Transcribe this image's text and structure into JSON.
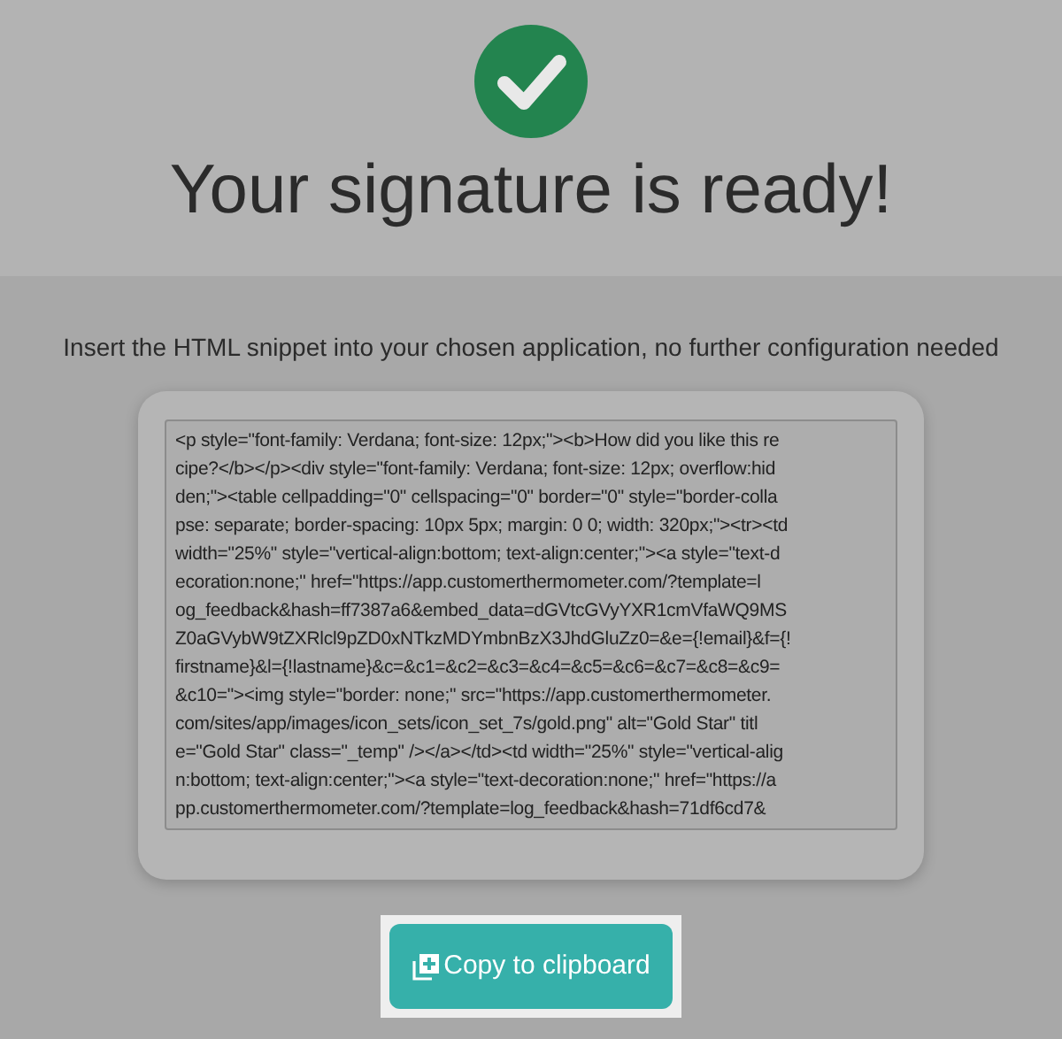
{
  "header": {
    "title": "Your signature is ready!"
  },
  "instruction": "Insert the HTML snippet into your chosen application, no further configuration needed",
  "snippet": {
    "lines": [
      "<p style=\"font-family: Verdana; font-size: 12px;\"><b>How did you like this re",
      "cipe?</b></p><div style=\"font-family: Verdana; font-size: 12px; overflow:hid",
      "den;\"><table cellpadding=\"0\" cellspacing=\"0\" border=\"0\" style=\"border-colla",
      "pse: separate; border-spacing: 10px 5px; margin: 0 0; width: 320px;\"><tr><td",
      "width=\"25%\" style=\"vertical-align:bottom; text-align:center;\"><a style=\"text-d",
      "ecoration:none;\" href=\"https://app.customerthermometer.com/?template=l",
      "og_feedback&hash=ff7387a6&embed_data=dGVtcGVyYXR1cmVfaWQ9MS",
      "Z0aGVybW9tZXRlcl9pZD0xNTkzMDYmbnBzX3JhdGluZz0=&e={!email}&f={!",
      "firstname}&l={!lastname}&c=&c1=&c2=&c3=&c4=&c5=&c6=&c7=&c8=&c9=",
      "&c10=\"><img style=\"border: none;\" src=\"https://app.customerthermometer.",
      "com/sites/app/images/icon_sets/icon_set_7s/gold.png\" alt=\"Gold Star\" titl",
      "e=\"Gold Star\" class=\"_temp\" /></a></td><td width=\"25%\" style=\"vertical-alig",
      "n:bottom; text-align:center;\"><a style=\"text-decoration:none;\" href=\"https://a",
      "pp.customerthermometer.com/?template=log_feedback&hash=71df6cd7&"
    ]
  },
  "copy_button": {
    "label": "Copy to clipboard"
  }
}
